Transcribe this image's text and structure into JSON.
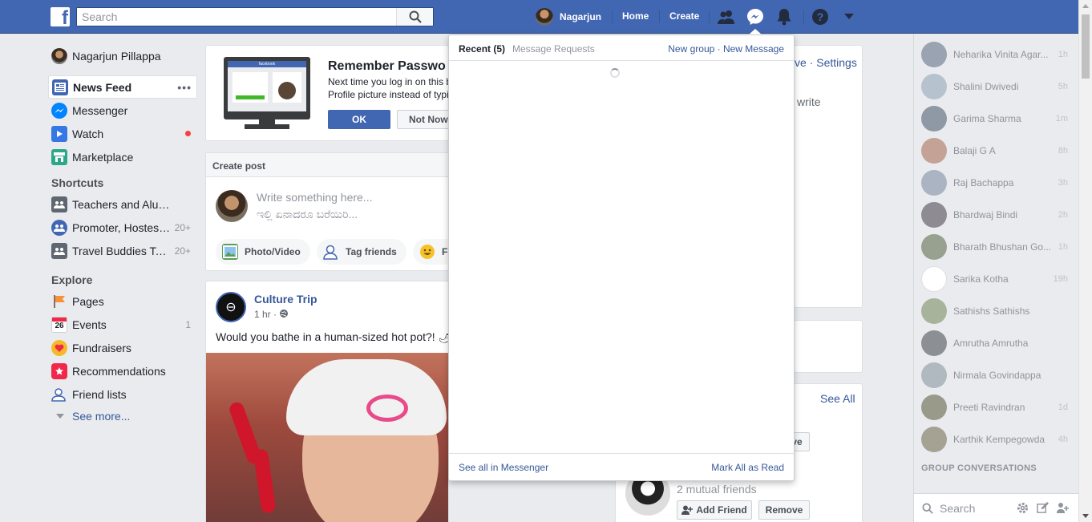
{
  "topbar": {
    "search_placeholder": "Search",
    "user_name": "Nagarjun",
    "home": "Home",
    "create": "Create"
  },
  "left_nav": {
    "profile_name": "Nagarjun Pillappa",
    "items": [
      {
        "label": "News Feed",
        "icon": "news-feed-icon"
      },
      {
        "label": "Messenger",
        "icon": "messenger-icon"
      },
      {
        "label": "Watch",
        "icon": "watch-icon"
      },
      {
        "label": "Marketplace",
        "icon": "marketplace-icon"
      }
    ],
    "shortcuts_heading": "Shortcuts",
    "shortcuts": [
      {
        "label": "Teachers and Alum...",
        "count": ""
      },
      {
        "label": "Promoter, Hostess...",
        "count": "20+"
      },
      {
        "label": "Travel Buddies Talk...",
        "count": "20+"
      }
    ],
    "explore_heading": "Explore",
    "explore": [
      {
        "label": "Pages",
        "count": ""
      },
      {
        "label": "Events",
        "count": "1"
      },
      {
        "label": "Fundraisers",
        "count": ""
      },
      {
        "label": "Recommendations",
        "count": ""
      },
      {
        "label": "Friend lists",
        "count": ""
      }
    ],
    "see_more": "See more..."
  },
  "remember": {
    "title": "Remember Passwo",
    "line1": "Next time you log in on this b",
    "line2": "Profile picture instead of typi",
    "ok": "OK",
    "not_now": "Not Now",
    "monitor_brand": "facebook"
  },
  "create_post": {
    "header": "Create post",
    "placeholder1": "Write something here...",
    "placeholder2": "ಇಲ್ಲಿ ಏನಾದರೂ ಬರೆಯಿರಿ...",
    "photo": "Photo/Video",
    "tag": "Tag friends",
    "feeling": "Fe"
  },
  "post": {
    "page_name": "Culture Trip",
    "time": "1 hr · ",
    "text": "Would you bathe in a human-sized hot pot?! 🌶"
  },
  "right_fragments": {
    "top_links": "ve · Settings",
    "write": "write",
    "see_all": "See All",
    "ve_btn": "ve",
    "mutual": "2 mutual friends",
    "add_friend": "Add Friend",
    "remove": "Remove"
  },
  "messenger": {
    "recent": "Recent (5)",
    "requests": "Message Requests",
    "actions": "New group · New Message",
    "see_all": "See all in Messenger",
    "mark_all": "Mark All as Read"
  },
  "chat": {
    "contacts": [
      {
        "name": "Neharika Vinita Agar...",
        "time": "1h"
      },
      {
        "name": "Shalini Dwivedi",
        "time": "5h"
      },
      {
        "name": "Garima Sharma",
        "time": "1m"
      },
      {
        "name": "Balaji G A",
        "time": "8h"
      },
      {
        "name": "Raj Bachappa",
        "time": "3h"
      },
      {
        "name": "Bhardwaj Bindi",
        "time": "2h"
      },
      {
        "name": "Bharath Bhushan Go...",
        "time": "1h"
      },
      {
        "name": "Sarika Kotha",
        "time": "19h"
      },
      {
        "name": "Sathishs Sathishs",
        "time": ""
      },
      {
        "name": "Amrutha Amrutha",
        "time": ""
      },
      {
        "name": "Nirmala Govindappa",
        "time": ""
      },
      {
        "name": "Preeti Ravindran",
        "time": "1d"
      },
      {
        "name": "Karthik Kempegowda",
        "time": "4h"
      }
    ],
    "group_heading": "GROUP CONVERSATIONS",
    "search_placeholder": "Search"
  },
  "colors": {
    "brand": "#4267b2",
    "link": "#365899",
    "notification": "#fa3e3e"
  }
}
